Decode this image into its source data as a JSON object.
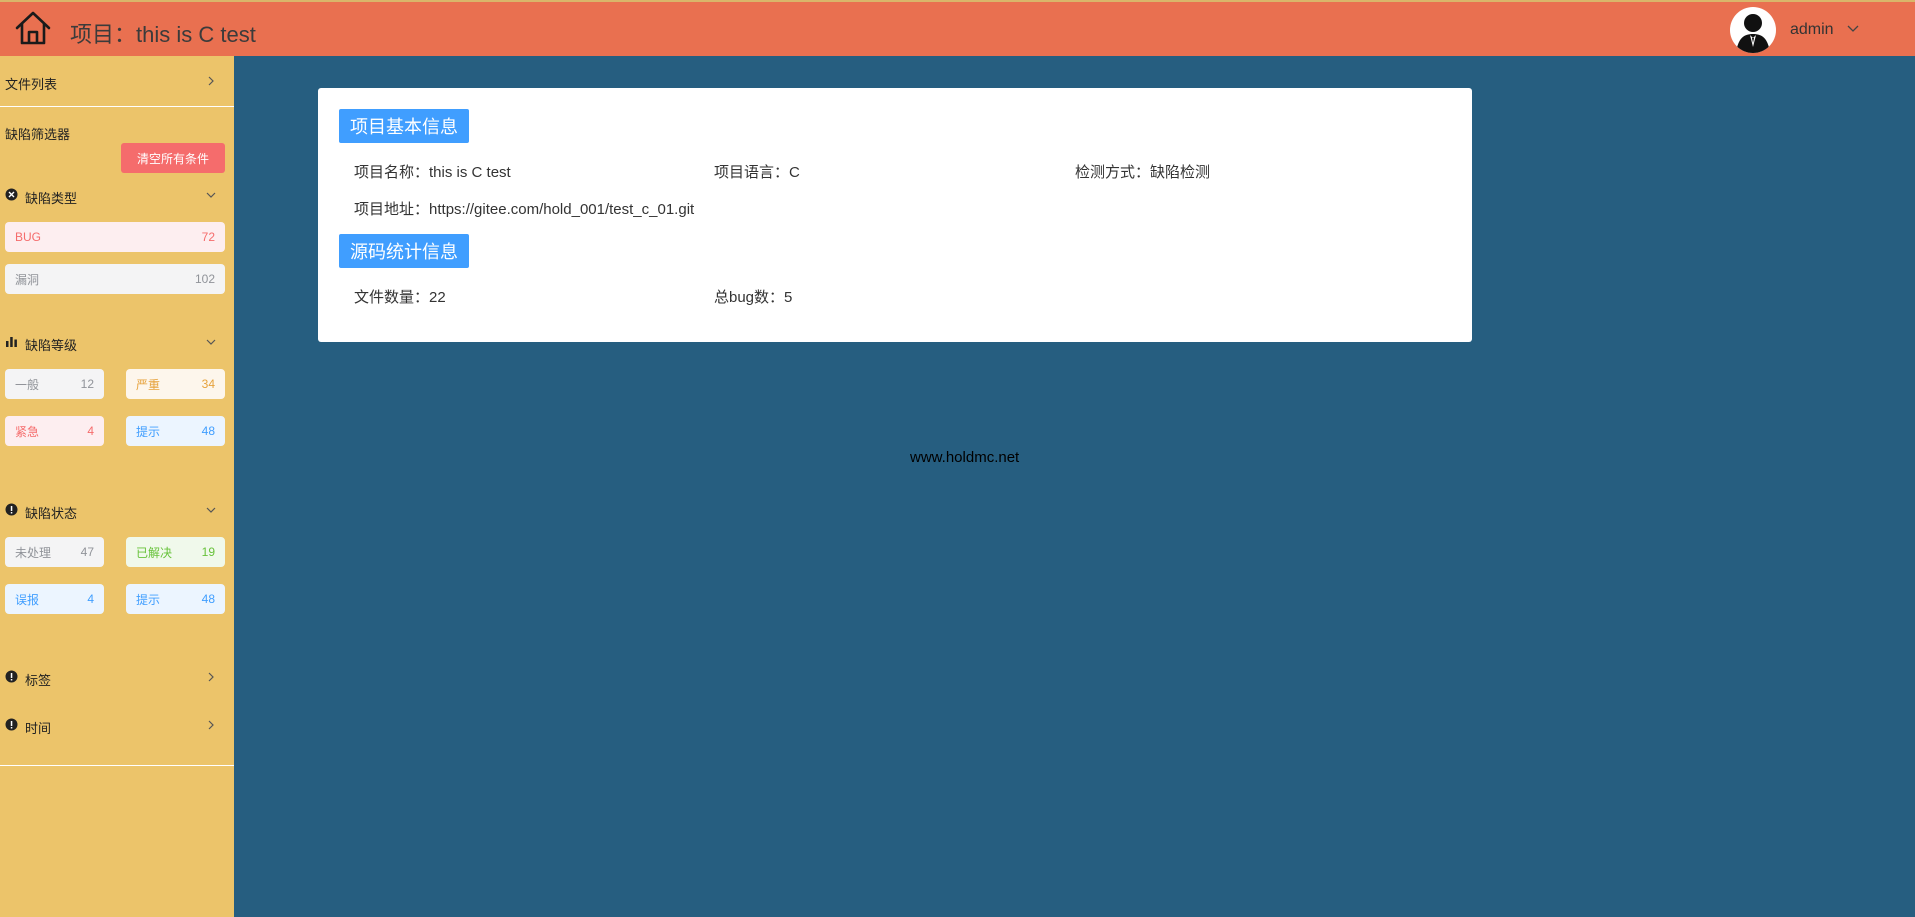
{
  "header": {
    "title_prefix": "项目：",
    "title": "this is C test",
    "user": "admin",
    "colors": {
      "bar": "#e97050"
    }
  },
  "sidebar": {
    "file_list": "文件列表",
    "filter_title": "缺陷筛选器",
    "clear_button": "清空所有条件",
    "sections": {
      "type": {
        "label": "缺陷类型",
        "items": [
          {
            "label": "BUG",
            "count": "72"
          },
          {
            "label": "漏洞",
            "count": "102"
          }
        ]
      },
      "level": {
        "label": "缺陷等级",
        "items": [
          {
            "label": "一般",
            "count": "12"
          },
          {
            "label": "严重",
            "count": "34"
          },
          {
            "label": "紧急",
            "count": "4"
          },
          {
            "label": "提示",
            "count": "48"
          }
        ]
      },
      "status": {
        "label": "缺陷状态",
        "items": [
          {
            "label": "未处理",
            "count": "47"
          },
          {
            "label": "已解决",
            "count": "19"
          },
          {
            "label": "误报",
            "count": "4"
          },
          {
            "label": "提示",
            "count": "48"
          }
        ]
      },
      "tags": {
        "label": "标签"
      },
      "time": {
        "label": "时间"
      }
    }
  },
  "main": {
    "basic_info": {
      "title": "项目基本信息",
      "name_label": "项目名称：",
      "name_value": "this is C test",
      "lang_label": "项目语言：",
      "lang_value": "C",
      "method_label": "检测方式：",
      "method_value": "缺陷检测",
      "url_label": "项目地址：",
      "url_value": "https://gitee.com/hold_001/test_c_01.git"
    },
    "source_stats": {
      "title": "源码统计信息",
      "files_label": "文件数量：",
      "files_value": "22",
      "bugs_label": "总bug数：",
      "bugs_value": "5"
    }
  },
  "footer": "www.holdmc.net"
}
